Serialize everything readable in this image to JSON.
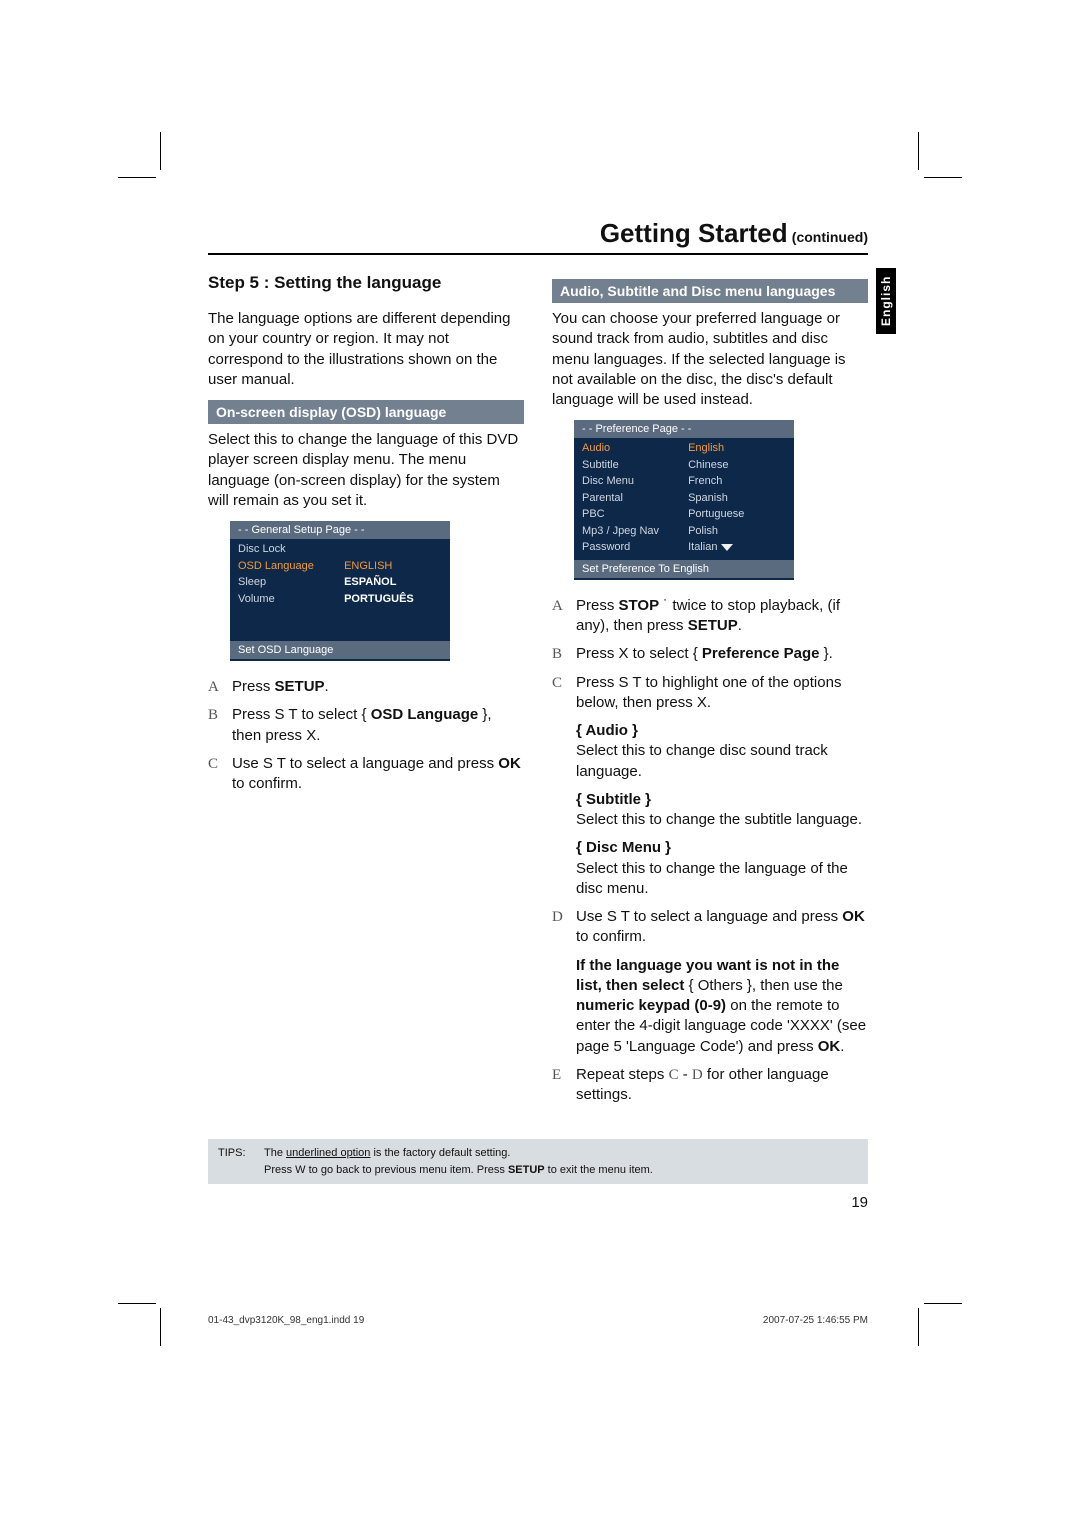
{
  "header": {
    "title": "Getting Started",
    "continued": "(continued)"
  },
  "sidebar": {
    "lang_tab": "English"
  },
  "left": {
    "step_heading": "Step 5 :  Setting the language",
    "intro": "The language options are different depending on your country or region. It may not correspond to the illustrations shown on the user manual.",
    "osd_sub": "On-screen display (OSD) language",
    "osd_desc": "Select this to change the language of this DVD player screen display menu. The menu language (on-screen display) for the system will remain as you set it.",
    "panel": {
      "header": "- -   General Setup Page   - -",
      "rows": [
        {
          "left": "Disc Lock",
          "right": ""
        },
        {
          "left": "OSD Language",
          "right": "ENGLISH",
          "left_cls": "hl-orange",
          "right_cls": "hl-orange"
        },
        {
          "left": "Sleep",
          "right": "ESPAÑOL",
          "right_cls": "hl-bold"
        },
        {
          "left": "Volume",
          "right": "PORTUGUÊS",
          "right_cls": "hl-bold"
        }
      ],
      "footer": "Set OSD Language"
    },
    "steps": {
      "a": {
        "letter": "A",
        "pre": "Press ",
        "bold": "SETUP",
        "post": "."
      },
      "b": {
        "letter": "B",
        "pre": "Press  S  T to select { ",
        "bold": "OSD Language",
        "post": " }, then press  X."
      },
      "c": {
        "letter": "C",
        "pre": "Use  S  T to select a language and press ",
        "bold": "OK",
        "post": " to confirm."
      }
    }
  },
  "right": {
    "sub": "Audio, Subtitle and Disc menu languages",
    "intro": "You can choose your preferred language or sound track from audio, subtitles and disc menu languages. If the selected language is not available on the disc, the disc's default language will be used instead.",
    "panel": {
      "header": "- -   Preference Page   - -",
      "rows": [
        {
          "left": "Audio",
          "right": "English",
          "left_cls": "hl-orange",
          "right_cls": "hl-orange"
        },
        {
          "left": "Subtitle",
          "right": "Chinese"
        },
        {
          "left": "Disc Menu",
          "right": "French"
        },
        {
          "left": "Parental",
          "right": "Spanish"
        },
        {
          "left": "PBC",
          "right": "  Portuguese"
        },
        {
          "left": "Mp3 / Jpeg Nav",
          "right": "Polish"
        },
        {
          "left": "Password",
          "right": "Italian",
          "arrow": true
        }
      ],
      "footer": "Set Preference To English"
    },
    "steps": {
      "a": {
        "letter": "A",
        "t1": "Press ",
        "bold1": "STOP",
        "t2": " ˙    twice to stop playback, (if any), then press ",
        "bold2": "SETUP",
        "t3": "."
      },
      "b": {
        "letter": "B",
        "t1": "Press  X to select { ",
        "bold1": "Preference Page",
        "t2": " }."
      },
      "c": {
        "letter": "C",
        "t1": "Press  S  T to highlight one of the options below, then press  X."
      }
    },
    "opts": {
      "audio": {
        "title": "{ Audio }",
        "desc": "Select this to change disc sound track language."
      },
      "subtitle": {
        "title": "{ Subtitle }",
        "desc": "Select this to change the subtitle language."
      },
      "discmenu": {
        "title": "{ Disc Menu }",
        "desc": "Select this to change the language of the disc menu."
      }
    },
    "d": {
      "letter": "D",
      "t1": "Use  S  T to select a language and press ",
      "bold1": "OK",
      "t2": " to confirm."
    },
    "others": {
      "b1": "If the language you want is not in the list, then select",
      "t1": " { Others }, then use the ",
      "b2": "numeric keypad (0-9)",
      "t2": " on the remote to enter the 4-digit language code 'XXXX' (see page 5 'Language Code') and press ",
      "b3": "OK",
      "t3": "."
    },
    "e": {
      "letter": "E",
      "t1": "Repeat steps ",
      "c": "C",
      "dash": " - ",
      "d": "D",
      "t2": " for other language settings."
    }
  },
  "tips": {
    "label": "TIPS:",
    "line1a": "The ",
    "line1u": "underlined option",
    "line1b": " is the factory default setting.",
    "line2a": "Press  W to go back to previous menu item. Press ",
    "line2bold": "SETUP",
    "line2b": " to exit the menu item."
  },
  "page_num": "19",
  "footer": {
    "file": "01-43_dvp3120K_98_eng1.indd   19",
    "stamp": "2007-07-25   1:46:55 PM"
  }
}
